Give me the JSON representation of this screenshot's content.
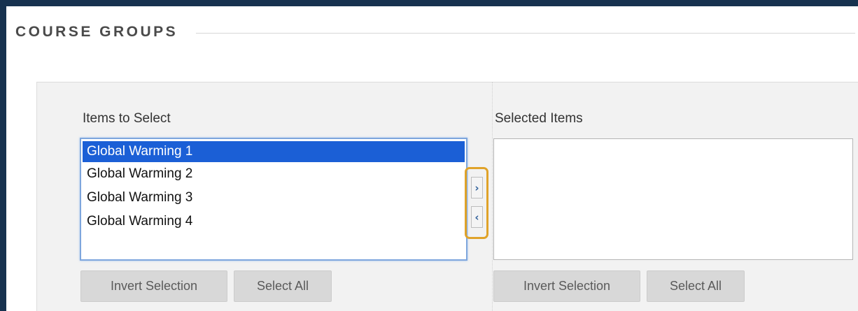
{
  "section": {
    "title": "COURSE GROUPS"
  },
  "left": {
    "label": "Items to Select",
    "items": [
      {
        "label": "Global Warming 1",
        "selected": true
      },
      {
        "label": "Global Warming 2",
        "selected": false
      },
      {
        "label": "Global Warming 3",
        "selected": false
      },
      {
        "label": "Global Warming 4",
        "selected": false
      }
    ],
    "invert_label": "Invert Selection",
    "select_all_label": "Select All"
  },
  "move": {
    "add_glyph": "›",
    "remove_glyph": "‹",
    "highlight_color": "#e0a32a"
  },
  "right": {
    "label": "Selected Items",
    "items": [],
    "invert_label": "Invert Selection",
    "select_all_label": "Select All"
  },
  "colors": {
    "selection": "#1b5fd6",
    "frame": "#17324f"
  }
}
